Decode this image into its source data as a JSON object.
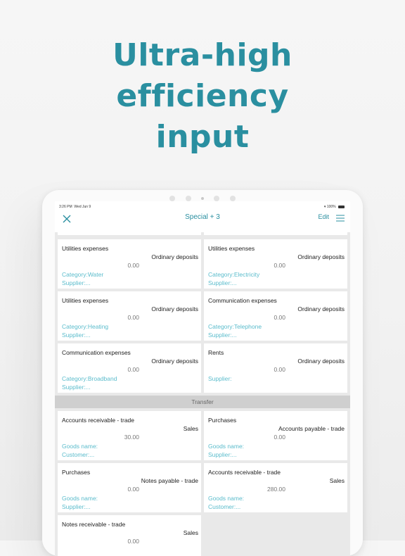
{
  "headline": {
    "line1": "Ultra-high",
    "line2": "efficiency",
    "line3": "input"
  },
  "status": {
    "time": "3:26 PM",
    "date": "Wed Jun 9",
    "battery": "100%"
  },
  "nav": {
    "title": "Special + 3",
    "edit": "Edit"
  },
  "colors": {
    "accent": "#2a8fa0",
    "link": "#5bbccc"
  },
  "cards": [
    {
      "name": "Utilities expenses",
      "account": "Ordinary deposits",
      "amount": "0.00",
      "line1": "Category:Water",
      "line2": "Supplier:..."
    },
    {
      "name": "Utilities expenses",
      "account": "Ordinary deposits",
      "amount": "0.00",
      "line1": "Category:Electricity",
      "line2": "Supplier:..."
    },
    {
      "name": "Utilities expenses",
      "account": "Ordinary deposits",
      "amount": "0.00",
      "line1": "Category:Heating",
      "line2": "Supplier:..."
    },
    {
      "name": "Communication expenses",
      "account": "Ordinary deposits",
      "amount": "0.00",
      "line1": "Category:Telephone",
      "line2": "Supplier:..."
    },
    {
      "name": "Communication expenses",
      "account": "Ordinary deposits",
      "amount": "0.00",
      "line1": "Category:Broadband",
      "line2": "Supplier:..."
    },
    {
      "name": "Rents",
      "account": "Ordinary deposits",
      "amount": "0.00",
      "line1": "Supplier:",
      "line2": ""
    }
  ],
  "section": {
    "label": "Transfer"
  },
  "transfers": [
    {
      "name": "Accounts receivable - trade",
      "account": "Sales",
      "amount": "30.00",
      "line1": "Goods name:",
      "line2": "Customer:..."
    },
    {
      "name": "Purchases",
      "account": "Accounts payable - trade",
      "amount": "0.00",
      "line1": "Goods name:",
      "line2": "Supplier:..."
    },
    {
      "name": "Purchases",
      "account": "Notes payable - trade",
      "amount": "0.00",
      "line1": "Goods name:",
      "line2": "Supplier:..."
    },
    {
      "name": "Accounts receivable - trade",
      "account": "Sales",
      "amount": "280.00",
      "line1": "Goods name:",
      "line2": "Customer:..."
    },
    {
      "name": "Notes receivable - trade",
      "account": "Sales",
      "amount": "0.00",
      "line1": "",
      "line2": ""
    }
  ]
}
